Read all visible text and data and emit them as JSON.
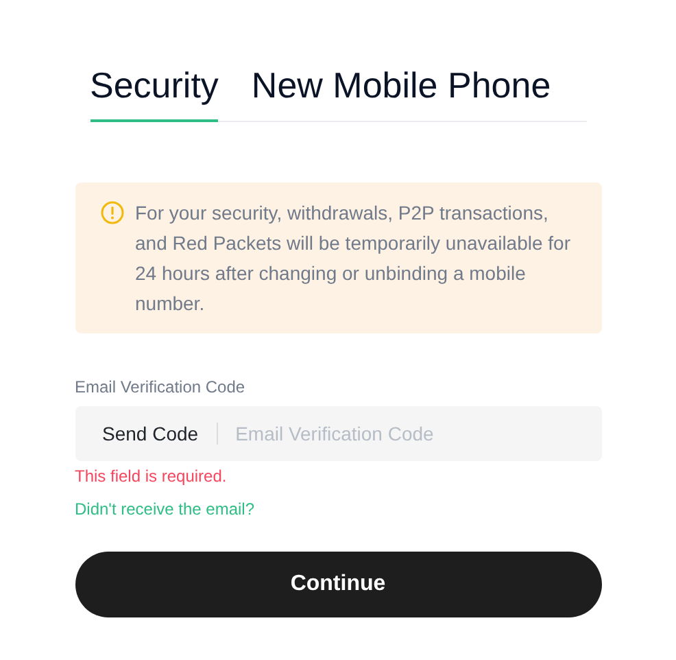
{
  "tabs": [
    {
      "label": "Security",
      "selected": true
    },
    {
      "label": "New Mobile Phone",
      "selected": false
    }
  ],
  "notice": {
    "text": "For your security, withdrawals, P2P transactions, and Red Packets will be temporarily unavailable for 24 hours after changing or unbinding a mobile number."
  },
  "email_code": {
    "label": "Email Verification Code",
    "send_button": "Send Code",
    "placeholder": "Email Verification Code",
    "error": "This field is required."
  },
  "help_link": "Didn't receive the email?",
  "submit_button": "Continue"
}
